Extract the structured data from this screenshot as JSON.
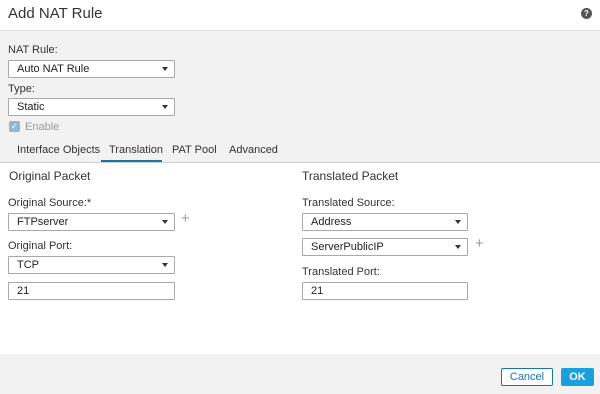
{
  "dialog": {
    "title": "Add NAT Rule",
    "help_icon": "?"
  },
  "config": {
    "nat_rule": {
      "label": "NAT Rule:",
      "value": "Auto NAT Rule"
    },
    "type": {
      "label": "Type:",
      "value": "Static"
    },
    "enable": {
      "label": "Enable",
      "checked": true,
      "check_glyph": "✓"
    }
  },
  "tabs": {
    "items": [
      "Interface Objects",
      "Translation",
      "PAT Pool",
      "Advanced"
    ],
    "active": "Translation"
  },
  "original_packet": {
    "title": "Original Packet",
    "source": {
      "label": "Original Source:*",
      "value": "FTPserver"
    },
    "port": {
      "label": "Original Port:",
      "protocol": "TCP",
      "value": "21"
    }
  },
  "translated_packet": {
    "title": "Translated Packet",
    "source": {
      "label": "Translated Source:",
      "type_value": "Address",
      "object_value": "ServerPublicIP"
    },
    "port": {
      "label": "Translated Port:",
      "value": "21"
    }
  },
  "add_glyph": "+",
  "footer": {
    "cancel_label": "Cancel",
    "ok_label": "OK"
  },
  "colors": {
    "accent": "#1875a4",
    "ok_button": "#1a9fe0",
    "panel_bg": "#f2f2f2"
  }
}
